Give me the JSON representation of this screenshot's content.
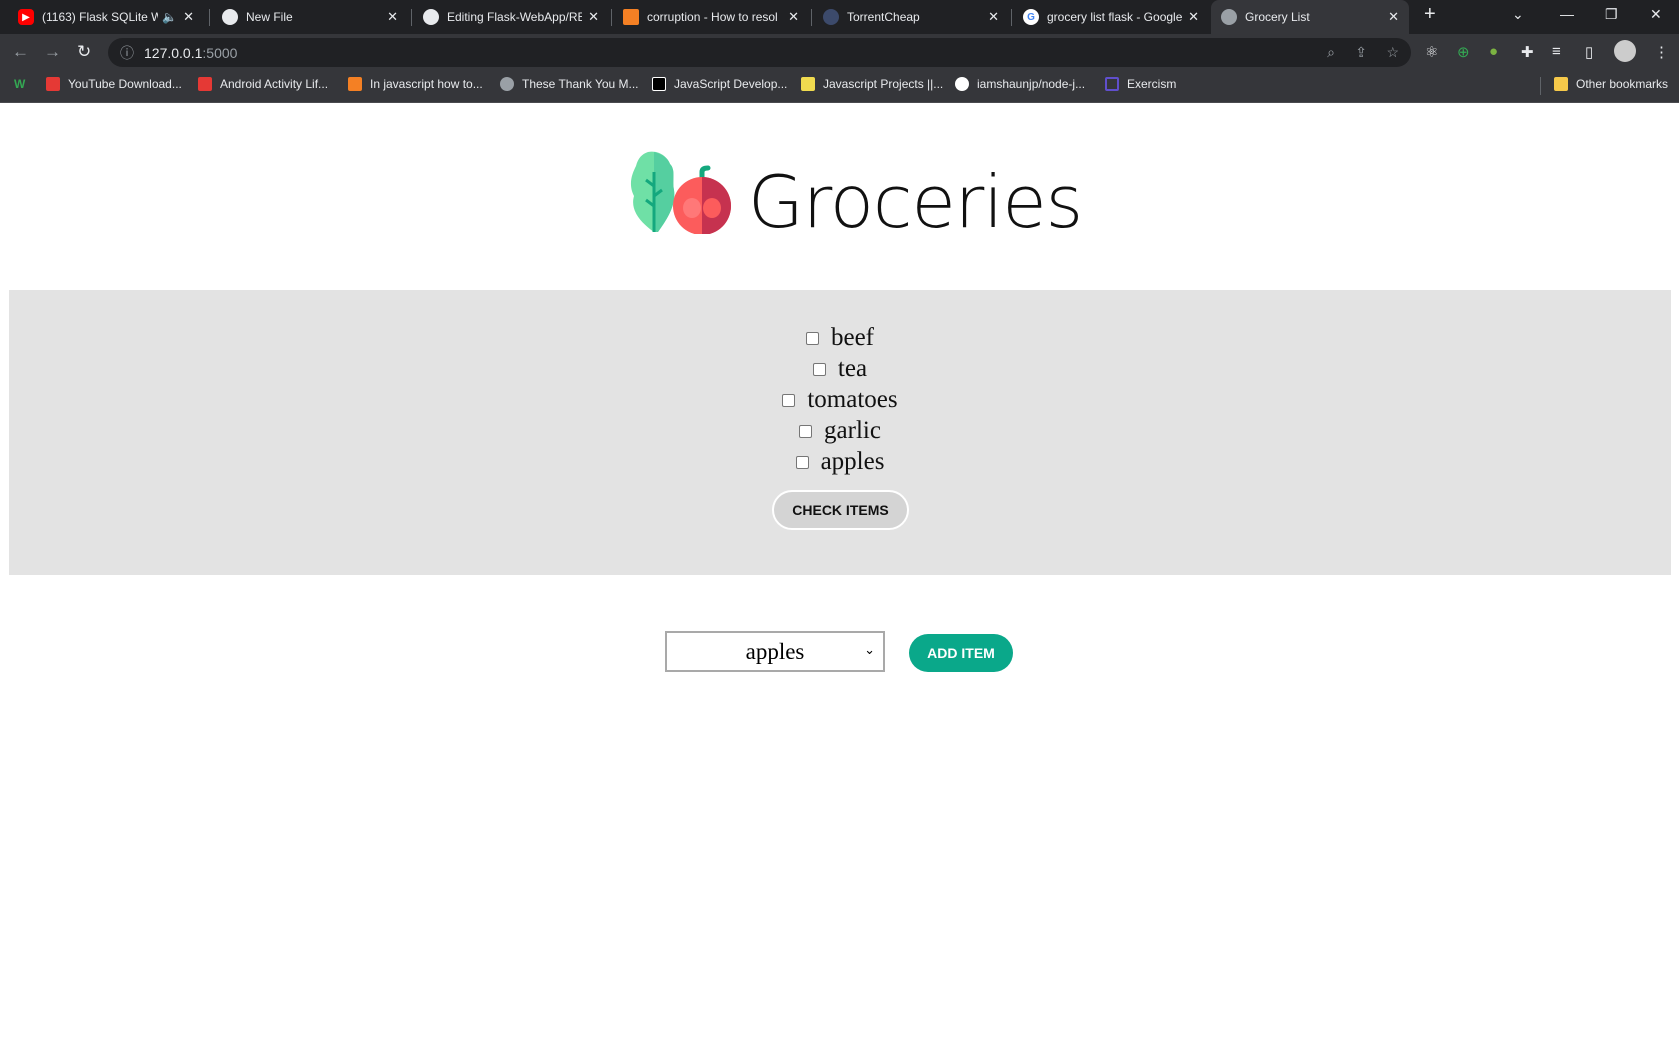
{
  "browser": {
    "tabs": [
      {
        "title": "(1163) Flask SQLite W",
        "icon": "youtube-icon",
        "audio": true
      },
      {
        "title": "New File",
        "icon": "github-icon"
      },
      {
        "title": "Editing Flask-WebApp/RE",
        "icon": "github-icon"
      },
      {
        "title": "corruption - How to resol",
        "icon": "stackoverflow-icon"
      },
      {
        "title": "TorrentCheap",
        "icon": "globe-icon"
      },
      {
        "title": "grocery list flask - Google",
        "icon": "google-icon"
      },
      {
        "title": "Grocery List",
        "icon": "globe-icon",
        "active": true
      }
    ],
    "url_host": "127.0.0.1",
    "url_port": ":5000",
    "bookmarks": [
      {
        "label": "YouTube Download...",
        "color": "#e53935"
      },
      {
        "label": "Android Activity Lif...",
        "color": "#e53935"
      },
      {
        "label": "In javascript how to...",
        "color": "#f48024"
      },
      {
        "label": "These Thank You M...",
        "color": "#9aa0a6"
      },
      {
        "label": "JavaScript Develop...",
        "color": "#000000"
      },
      {
        "label": "Javascript Projects ||...",
        "color": "#f0db4f"
      },
      {
        "label": "iamshaunjp/node-j...",
        "color": "#ffffff"
      },
      {
        "label": "Exercism",
        "color": "#604fcd"
      }
    ],
    "other_bookmarks": "Other bookmarks"
  },
  "page": {
    "title": "Groceries",
    "items": [
      "beef",
      "tea",
      "tomatoes",
      "garlic",
      "apples"
    ],
    "check_button": "CHECK ITEMS",
    "select_value": "apples",
    "add_button": "ADD ITEM",
    "accent_color": "#0aa88a",
    "panel_color": "#e3e3e3"
  }
}
